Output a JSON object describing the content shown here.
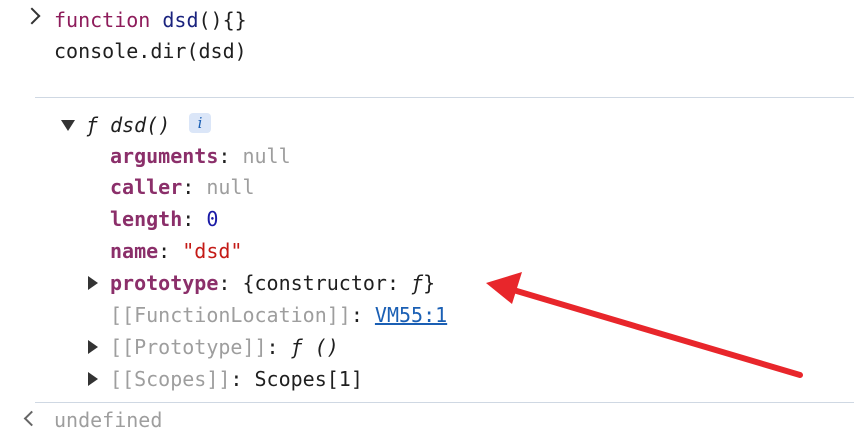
{
  "input": {
    "line1_keyword": "function",
    "line1_name": "dsd",
    "line1_rest": "(){}",
    "line2": "console.dir(dsd)"
  },
  "output": {
    "header_f": "ƒ",
    "header_sig": "dsd()",
    "info_badge": "i",
    "props": [
      {
        "key": "arguments",
        "value": "null"
      },
      {
        "key": "caller",
        "value": "null"
      },
      {
        "key": "length",
        "value": "0"
      },
      {
        "key": "name",
        "value": "\"dsd\""
      },
      {
        "key": "prototype",
        "value_prefix": "{constructor: ",
        "value_f": "ƒ",
        "value_suffix": "}"
      }
    ],
    "function_location": {
      "key": "[[FunctionLocation]]",
      "link": "VM55:1"
    },
    "prototype_internal": {
      "key": "[[Prototype]]",
      "value": "ƒ ()"
    },
    "scopes": {
      "key": "[[Scopes]]",
      "value": "Scopes[1]"
    },
    "colon": ": "
  },
  "result": {
    "text": "undefined"
  },
  "colors": {
    "annotation_arrow": "#e8262b"
  }
}
